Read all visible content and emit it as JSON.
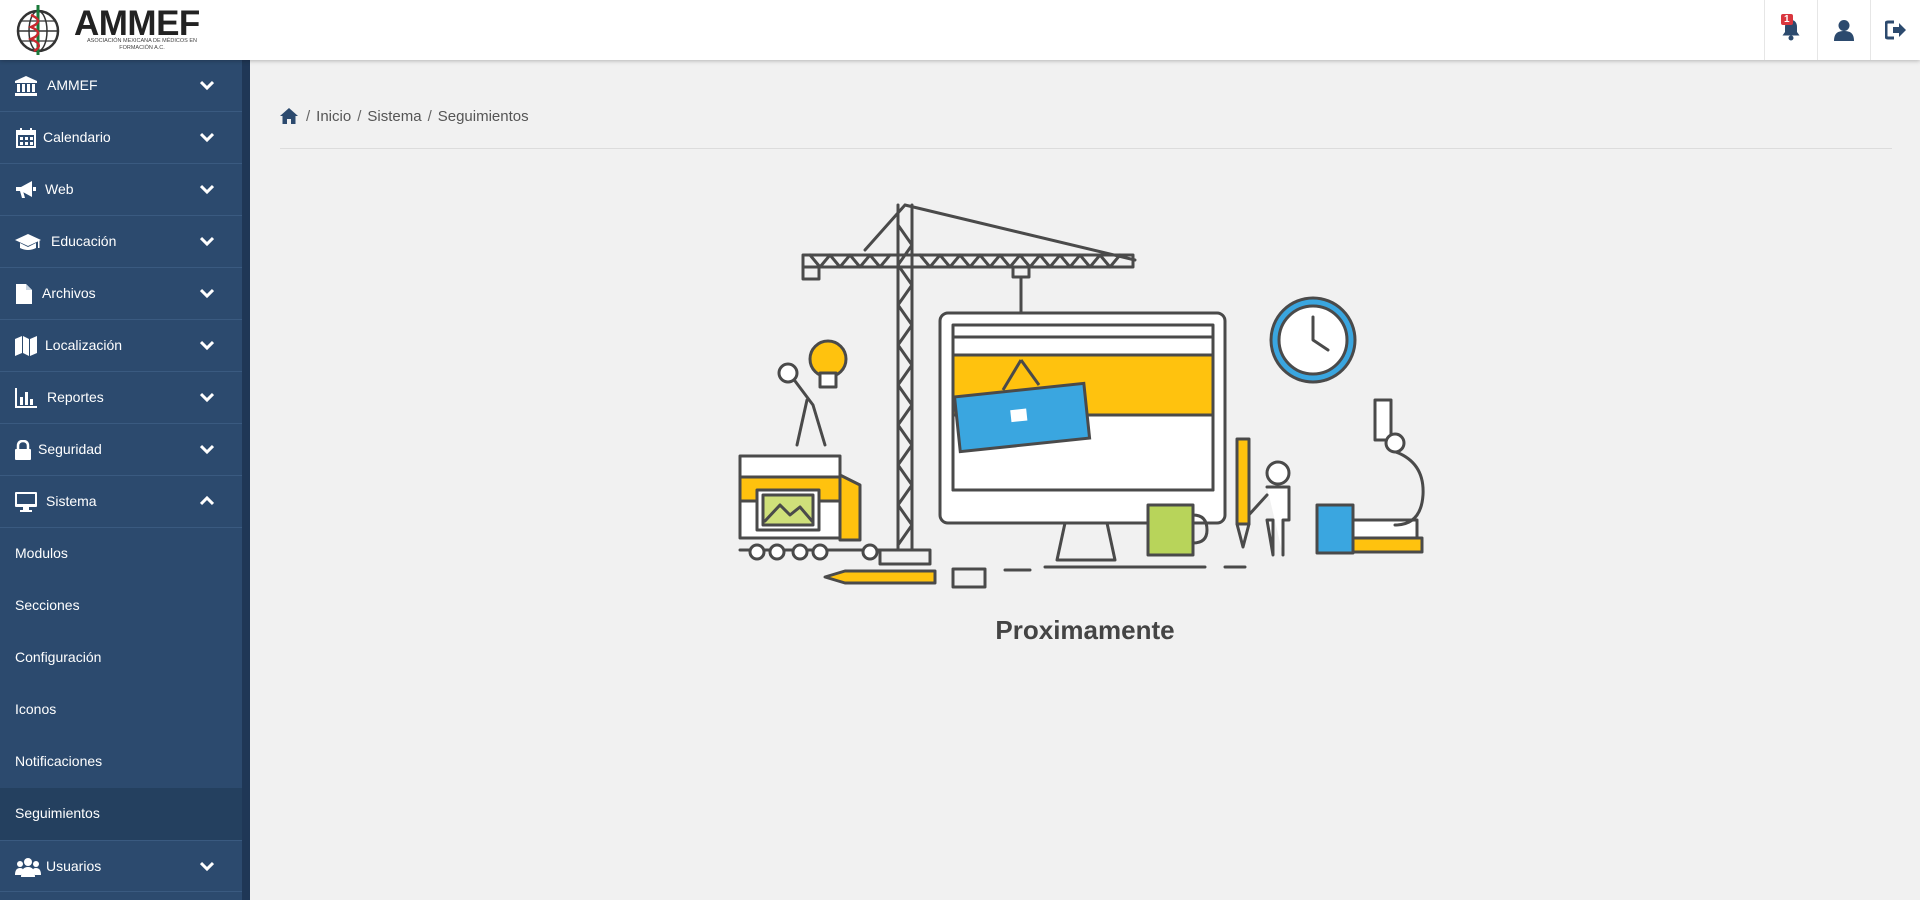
{
  "header": {
    "logo_text": "AMMEF",
    "logo_subtitle": "ASOCIACIÓN MEXICANA DE MÉDICOS EN FORMACIÓN A.C.",
    "notification_count": "1"
  },
  "sidebar": {
    "items": [
      {
        "label": "AMMEF",
        "icon": "bank-icon"
      },
      {
        "label": "Calendario",
        "icon": "calendar-icon"
      },
      {
        "label": "Web",
        "icon": "bullhorn-icon"
      },
      {
        "label": "Educación",
        "icon": "graduation-cap-icon"
      },
      {
        "label": "Archivos",
        "icon": "file-icon"
      },
      {
        "label": "Localización",
        "icon": "map-icon"
      },
      {
        "label": "Reportes",
        "icon": "bar-chart-icon"
      },
      {
        "label": "Seguridad",
        "icon": "lock-icon"
      },
      {
        "label": "Sistema",
        "icon": "desktop-icon",
        "expanded": true
      }
    ],
    "sub_items": [
      {
        "label": "Modulos"
      },
      {
        "label": "Secciones"
      },
      {
        "label": "Configuración"
      },
      {
        "label": "Iconos"
      },
      {
        "label": "Notificaciones"
      },
      {
        "label": "Seguimientos",
        "active": true
      }
    ],
    "last_item": {
      "label": "Usuarios",
      "icon": "users-icon"
    }
  },
  "breadcrumb": [
    "Inicio",
    "Sistema",
    "Seguimientos"
  ],
  "main": {
    "title": "Proximamente"
  },
  "colors": {
    "sidebar_bg": "#2c4a6e",
    "sidebar_active": "#24405f",
    "accent_yellow": "#ffc20e",
    "accent_blue": "#3aa6e0",
    "badge_red": "#d9363e"
  }
}
